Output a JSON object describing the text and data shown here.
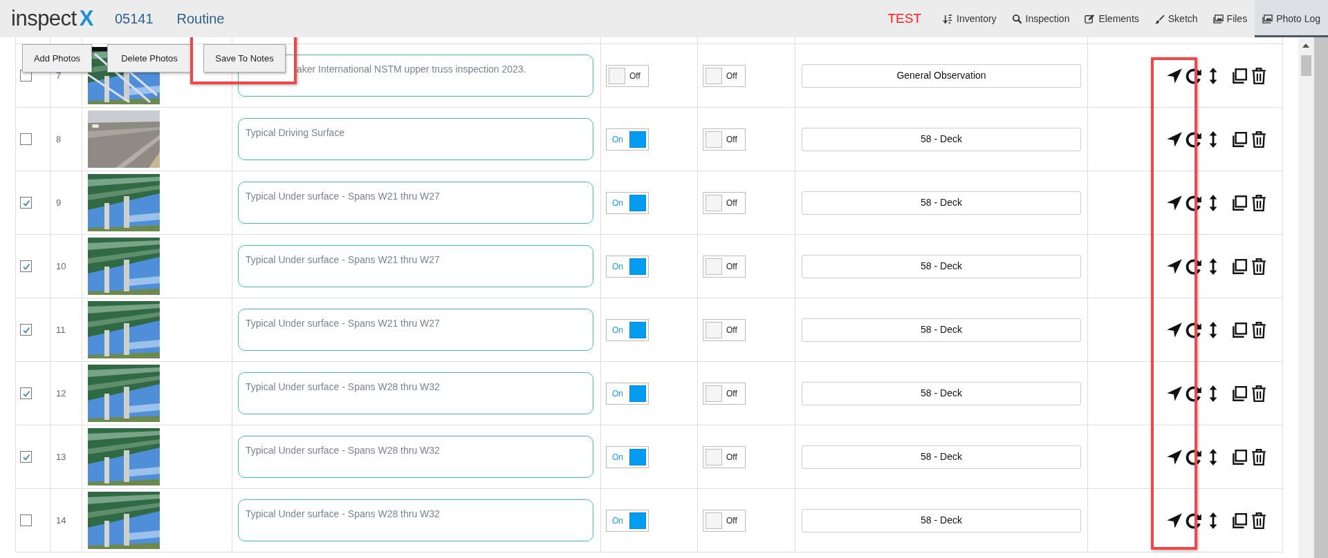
{
  "header": {
    "logo_text": "inspect",
    "logo_mark": "X",
    "structure_number": "05141",
    "inspection_type": "Routine",
    "environment": "TEST"
  },
  "nav": [
    {
      "label": "Inventory",
      "selected": false
    },
    {
      "label": "Inspection",
      "selected": false
    },
    {
      "label": "Elements",
      "selected": false
    },
    {
      "label": "Sketch",
      "selected": false
    },
    {
      "label": "Files",
      "selected": false
    },
    {
      "label": "Photo Log",
      "selected": true
    }
  ],
  "toolbar": [
    {
      "label": "Add Photos",
      "highlighted": false
    },
    {
      "label": "Delete Photos",
      "highlighted": false
    },
    {
      "label": "Save To Notes",
      "highlighted": true
    }
  ],
  "actions_highlighted": true,
  "photos": [
    {
      "number": "7",
      "checked": false,
      "note": "aker International NSTM upper truss inspection 2023.",
      "toggle_1": {
        "on": false,
        "label": "Off"
      },
      "toggle_2": {
        "on": false,
        "label": "Off"
      },
      "element": "General Observation"
    },
    {
      "number": "8",
      "checked": false,
      "note": "Typical Driving Surface",
      "toggle_1": {
        "on": true,
        "label": "On"
      },
      "toggle_2": {
        "on": false,
        "label": "Off"
      },
      "element": "58 - Deck"
    },
    {
      "number": "9",
      "checked": true,
      "note": "Typical Under surface - Spans W21 thru W27",
      "toggle_1": {
        "on": true,
        "label": "On"
      },
      "toggle_2": {
        "on": false,
        "label": "Off"
      },
      "element": "58 - Deck"
    },
    {
      "number": "10",
      "checked": true,
      "note": "Typical Under surface - Spans W21 thru W27",
      "toggle_1": {
        "on": true,
        "label": "On"
      },
      "toggle_2": {
        "on": false,
        "label": "Off"
      },
      "element": "58 - Deck"
    },
    {
      "number": "11",
      "checked": true,
      "note": "Typical Under surface - Spans W21 thru W27",
      "toggle_1": {
        "on": true,
        "label": "On"
      },
      "toggle_2": {
        "on": false,
        "label": "Off"
      },
      "element": "58 - Deck"
    },
    {
      "number": "12",
      "checked": true,
      "note": "Typical Under surface - Spans W28 thru W32",
      "toggle_1": {
        "on": true,
        "label": "On"
      },
      "toggle_2": {
        "on": false,
        "label": "Off"
      },
      "element": "58 - Deck"
    },
    {
      "number": "13",
      "checked": true,
      "note": "Typical Under surface - Spans W28 thru W32",
      "toggle_1": {
        "on": true,
        "label": "On"
      },
      "toggle_2": {
        "on": false,
        "label": "Off"
      },
      "element": "58 - Deck"
    },
    {
      "number": "14",
      "checked": false,
      "note": "Typical Under surface - Spans W28 thru W32",
      "toggle_1": {
        "on": true,
        "label": "On"
      },
      "toggle_2": {
        "on": false,
        "label": "Off"
      },
      "element": "58 - Deck"
    }
  ]
}
